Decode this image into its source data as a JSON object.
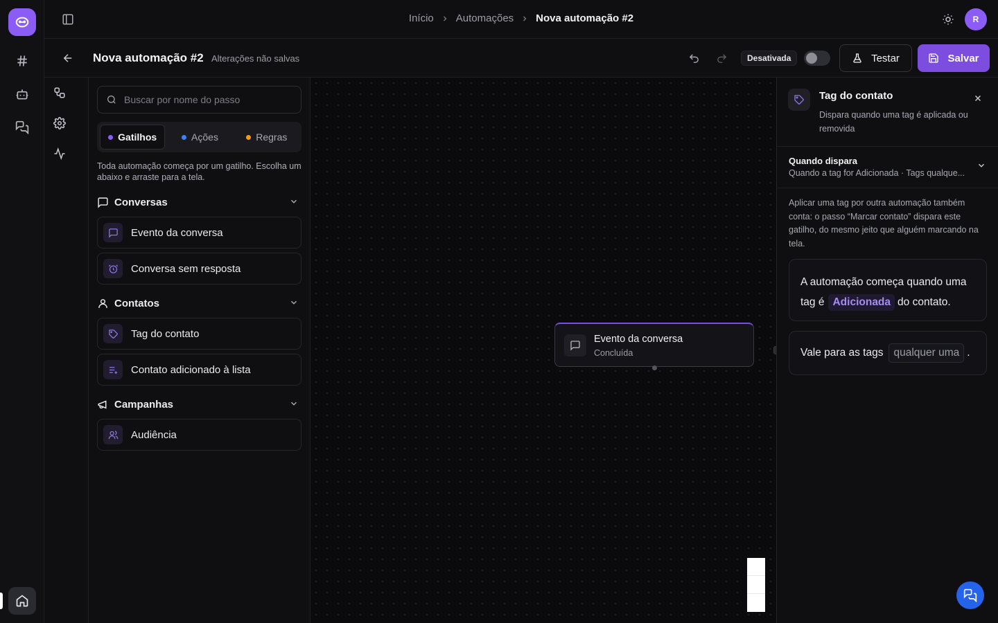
{
  "breadcrumb": {
    "items": [
      "Início",
      "Automações"
    ],
    "current": "Nova automação #2",
    "separator": ">"
  },
  "user": {
    "avatar_initial": "R"
  },
  "header": {
    "title": "Nova automação #2",
    "unsaved_label": "Alterações não salvas",
    "status_label": "Desativada",
    "status_enabled": false,
    "test_label": "Testar",
    "save_label": "Salvar"
  },
  "steps_panel": {
    "search_placeholder": "Buscar por nome do passo",
    "search_value": "",
    "tabs": [
      {
        "label": "Gatilhos",
        "dot_color": "#8b5cf6",
        "active": true
      },
      {
        "label": "Ações",
        "dot_color": "#3b82f6",
        "active": false
      },
      {
        "label": "Regras",
        "dot_color": "#f59e0b",
        "active": false
      }
    ],
    "intro": "Toda automação começa por um gatilho. Escolha um abaixo e arraste para a tela.",
    "sections": [
      {
        "label": "Conversas",
        "icon": "message-square-icon",
        "items": [
          {
            "label": "Evento da conversa",
            "icon": "message-square-icon"
          },
          {
            "label": "Conversa sem resposta",
            "icon": "alarm-clock-icon"
          }
        ]
      },
      {
        "label": "Contatos",
        "icon": "user-icon",
        "items": [
          {
            "label": "Tag do contato",
            "icon": "tag-icon"
          },
          {
            "label": "Contato adicionado à lista",
            "icon": "list-plus-icon"
          }
        ]
      },
      {
        "label": "Campanhas",
        "icon": "megaphone-icon",
        "items": [
          {
            "label": "Audiência",
            "icon": "users-icon"
          }
        ]
      }
    ]
  },
  "canvas": {
    "node": {
      "title": "Evento da conversa",
      "subtitle": "Concluída",
      "icon": "message-square-icon",
      "accent": "#7c4ddf"
    }
  },
  "details_panel": {
    "title": "Tag do contato",
    "description": "Dispara quando uma tag é aplicada ou removida",
    "when": {
      "heading": "Quando dispara",
      "summary": "Quando a tag for Adicionada · Tags qualque..."
    },
    "note": "Aplicar uma tag por outra automação também conta: o passo “Marcar contato” dispara este gatilho, do mesmo jeito que alguém marcando na tela.",
    "sentence1": {
      "before": "A automação começa quando uma tag é",
      "chip": "Adicionada",
      "after": "do contato."
    },
    "sentence2": {
      "before": "Vale para as tags",
      "chip": "qualquer uma",
      "after": "."
    }
  },
  "colors": {
    "accent": "#8b5cf6",
    "save_button": "#7c4ddf",
    "chat_fab": "#2563eb"
  }
}
